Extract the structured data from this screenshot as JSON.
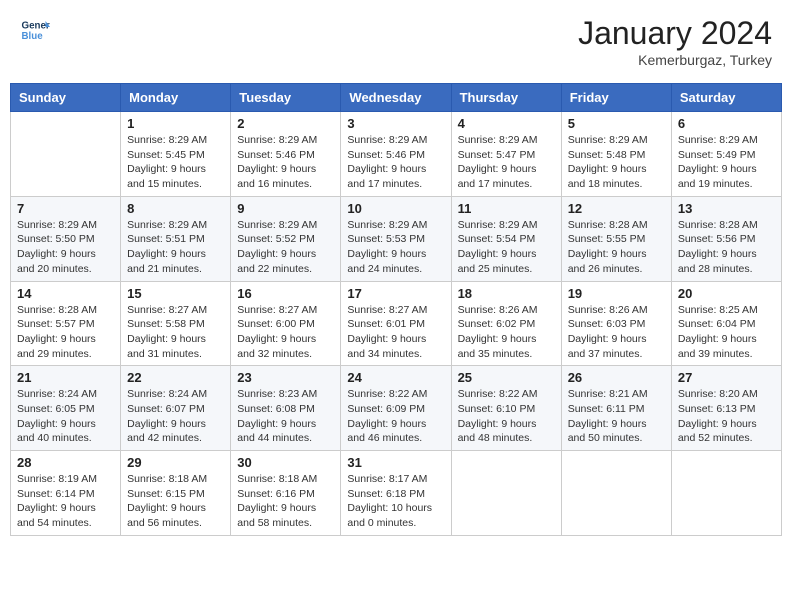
{
  "header": {
    "logo_general": "General",
    "logo_blue": "Blue",
    "month_title": "January 2024",
    "location": "Kemerburgaz, Turkey"
  },
  "days_of_week": [
    "Sunday",
    "Monday",
    "Tuesday",
    "Wednesday",
    "Thursday",
    "Friday",
    "Saturday"
  ],
  "weeks": [
    [
      {
        "day": "",
        "sunrise": "",
        "sunset": "",
        "daylight": ""
      },
      {
        "day": "1",
        "sunrise": "Sunrise: 8:29 AM",
        "sunset": "Sunset: 5:45 PM",
        "daylight": "Daylight: 9 hours and 15 minutes."
      },
      {
        "day": "2",
        "sunrise": "Sunrise: 8:29 AM",
        "sunset": "Sunset: 5:46 PM",
        "daylight": "Daylight: 9 hours and 16 minutes."
      },
      {
        "day": "3",
        "sunrise": "Sunrise: 8:29 AM",
        "sunset": "Sunset: 5:46 PM",
        "daylight": "Daylight: 9 hours and 17 minutes."
      },
      {
        "day": "4",
        "sunrise": "Sunrise: 8:29 AM",
        "sunset": "Sunset: 5:47 PM",
        "daylight": "Daylight: 9 hours and 17 minutes."
      },
      {
        "day": "5",
        "sunrise": "Sunrise: 8:29 AM",
        "sunset": "Sunset: 5:48 PM",
        "daylight": "Daylight: 9 hours and 18 minutes."
      },
      {
        "day": "6",
        "sunrise": "Sunrise: 8:29 AM",
        "sunset": "Sunset: 5:49 PM",
        "daylight": "Daylight: 9 hours and 19 minutes."
      }
    ],
    [
      {
        "day": "7",
        "sunrise": "Sunrise: 8:29 AM",
        "sunset": "Sunset: 5:50 PM",
        "daylight": "Daylight: 9 hours and 20 minutes."
      },
      {
        "day": "8",
        "sunrise": "Sunrise: 8:29 AM",
        "sunset": "Sunset: 5:51 PM",
        "daylight": "Daylight: 9 hours and 21 minutes."
      },
      {
        "day": "9",
        "sunrise": "Sunrise: 8:29 AM",
        "sunset": "Sunset: 5:52 PM",
        "daylight": "Daylight: 9 hours and 22 minutes."
      },
      {
        "day": "10",
        "sunrise": "Sunrise: 8:29 AM",
        "sunset": "Sunset: 5:53 PM",
        "daylight": "Daylight: 9 hours and 24 minutes."
      },
      {
        "day": "11",
        "sunrise": "Sunrise: 8:29 AM",
        "sunset": "Sunset: 5:54 PM",
        "daylight": "Daylight: 9 hours and 25 minutes."
      },
      {
        "day": "12",
        "sunrise": "Sunrise: 8:28 AM",
        "sunset": "Sunset: 5:55 PM",
        "daylight": "Daylight: 9 hours and 26 minutes."
      },
      {
        "day": "13",
        "sunrise": "Sunrise: 8:28 AM",
        "sunset": "Sunset: 5:56 PM",
        "daylight": "Daylight: 9 hours and 28 minutes."
      }
    ],
    [
      {
        "day": "14",
        "sunrise": "Sunrise: 8:28 AM",
        "sunset": "Sunset: 5:57 PM",
        "daylight": "Daylight: 9 hours and 29 minutes."
      },
      {
        "day": "15",
        "sunrise": "Sunrise: 8:27 AM",
        "sunset": "Sunset: 5:58 PM",
        "daylight": "Daylight: 9 hours and 31 minutes."
      },
      {
        "day": "16",
        "sunrise": "Sunrise: 8:27 AM",
        "sunset": "Sunset: 6:00 PM",
        "daylight": "Daylight: 9 hours and 32 minutes."
      },
      {
        "day": "17",
        "sunrise": "Sunrise: 8:27 AM",
        "sunset": "Sunset: 6:01 PM",
        "daylight": "Daylight: 9 hours and 34 minutes."
      },
      {
        "day": "18",
        "sunrise": "Sunrise: 8:26 AM",
        "sunset": "Sunset: 6:02 PM",
        "daylight": "Daylight: 9 hours and 35 minutes."
      },
      {
        "day": "19",
        "sunrise": "Sunrise: 8:26 AM",
        "sunset": "Sunset: 6:03 PM",
        "daylight": "Daylight: 9 hours and 37 minutes."
      },
      {
        "day": "20",
        "sunrise": "Sunrise: 8:25 AM",
        "sunset": "Sunset: 6:04 PM",
        "daylight": "Daylight: 9 hours and 39 minutes."
      }
    ],
    [
      {
        "day": "21",
        "sunrise": "Sunrise: 8:24 AM",
        "sunset": "Sunset: 6:05 PM",
        "daylight": "Daylight: 9 hours and 40 minutes."
      },
      {
        "day": "22",
        "sunrise": "Sunrise: 8:24 AM",
        "sunset": "Sunset: 6:07 PM",
        "daylight": "Daylight: 9 hours and 42 minutes."
      },
      {
        "day": "23",
        "sunrise": "Sunrise: 8:23 AM",
        "sunset": "Sunset: 6:08 PM",
        "daylight": "Daylight: 9 hours and 44 minutes."
      },
      {
        "day": "24",
        "sunrise": "Sunrise: 8:22 AM",
        "sunset": "Sunset: 6:09 PM",
        "daylight": "Daylight: 9 hours and 46 minutes."
      },
      {
        "day": "25",
        "sunrise": "Sunrise: 8:22 AM",
        "sunset": "Sunset: 6:10 PM",
        "daylight": "Daylight: 9 hours and 48 minutes."
      },
      {
        "day": "26",
        "sunrise": "Sunrise: 8:21 AM",
        "sunset": "Sunset: 6:11 PM",
        "daylight": "Daylight: 9 hours and 50 minutes."
      },
      {
        "day": "27",
        "sunrise": "Sunrise: 8:20 AM",
        "sunset": "Sunset: 6:13 PM",
        "daylight": "Daylight: 9 hours and 52 minutes."
      }
    ],
    [
      {
        "day": "28",
        "sunrise": "Sunrise: 8:19 AM",
        "sunset": "Sunset: 6:14 PM",
        "daylight": "Daylight: 9 hours and 54 minutes."
      },
      {
        "day": "29",
        "sunrise": "Sunrise: 8:18 AM",
        "sunset": "Sunset: 6:15 PM",
        "daylight": "Daylight: 9 hours and 56 minutes."
      },
      {
        "day": "30",
        "sunrise": "Sunrise: 8:18 AM",
        "sunset": "Sunset: 6:16 PM",
        "daylight": "Daylight: 9 hours and 58 minutes."
      },
      {
        "day": "31",
        "sunrise": "Sunrise: 8:17 AM",
        "sunset": "Sunset: 6:18 PM",
        "daylight": "Daylight: 10 hours and 0 minutes."
      },
      {
        "day": "",
        "sunrise": "",
        "sunset": "",
        "daylight": ""
      },
      {
        "day": "",
        "sunrise": "",
        "sunset": "",
        "daylight": ""
      },
      {
        "day": "",
        "sunrise": "",
        "sunset": "",
        "daylight": ""
      }
    ]
  ]
}
